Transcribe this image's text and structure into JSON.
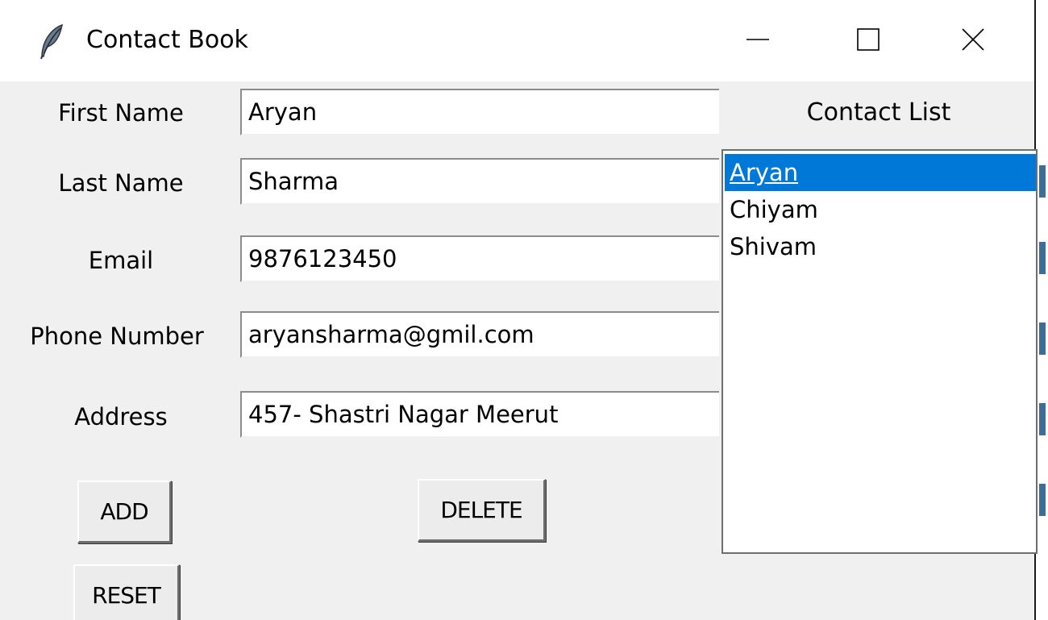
{
  "window": {
    "title": "Contact Book",
    "icon": "feather-icon",
    "controls": {
      "minimize_icon": "minimize-icon",
      "maximize_icon": "maximize-icon",
      "close_icon": "close-icon"
    }
  },
  "form": {
    "first_name": {
      "label": "First Name",
      "value": "Aryan"
    },
    "last_name": {
      "label": "Last Name",
      "value": "Sharma"
    },
    "email": {
      "label": "Email",
      "value": "9876123450"
    },
    "phone": {
      "label": "Phone Number",
      "value": "aryansharma@gmil.com"
    },
    "address": {
      "label": "Address",
      "value": "457- Shastri Nagar Meerut"
    }
  },
  "buttons": {
    "add": "ADD",
    "delete": "DELETE",
    "reset": "RESET"
  },
  "contact_list": {
    "title": "Contact List",
    "items": [
      "Aryan",
      "Chiyam",
      "Shivam"
    ],
    "selected": "Aryan"
  },
  "colors": {
    "selection": "#0078d7",
    "background": "#f0f0f0"
  }
}
